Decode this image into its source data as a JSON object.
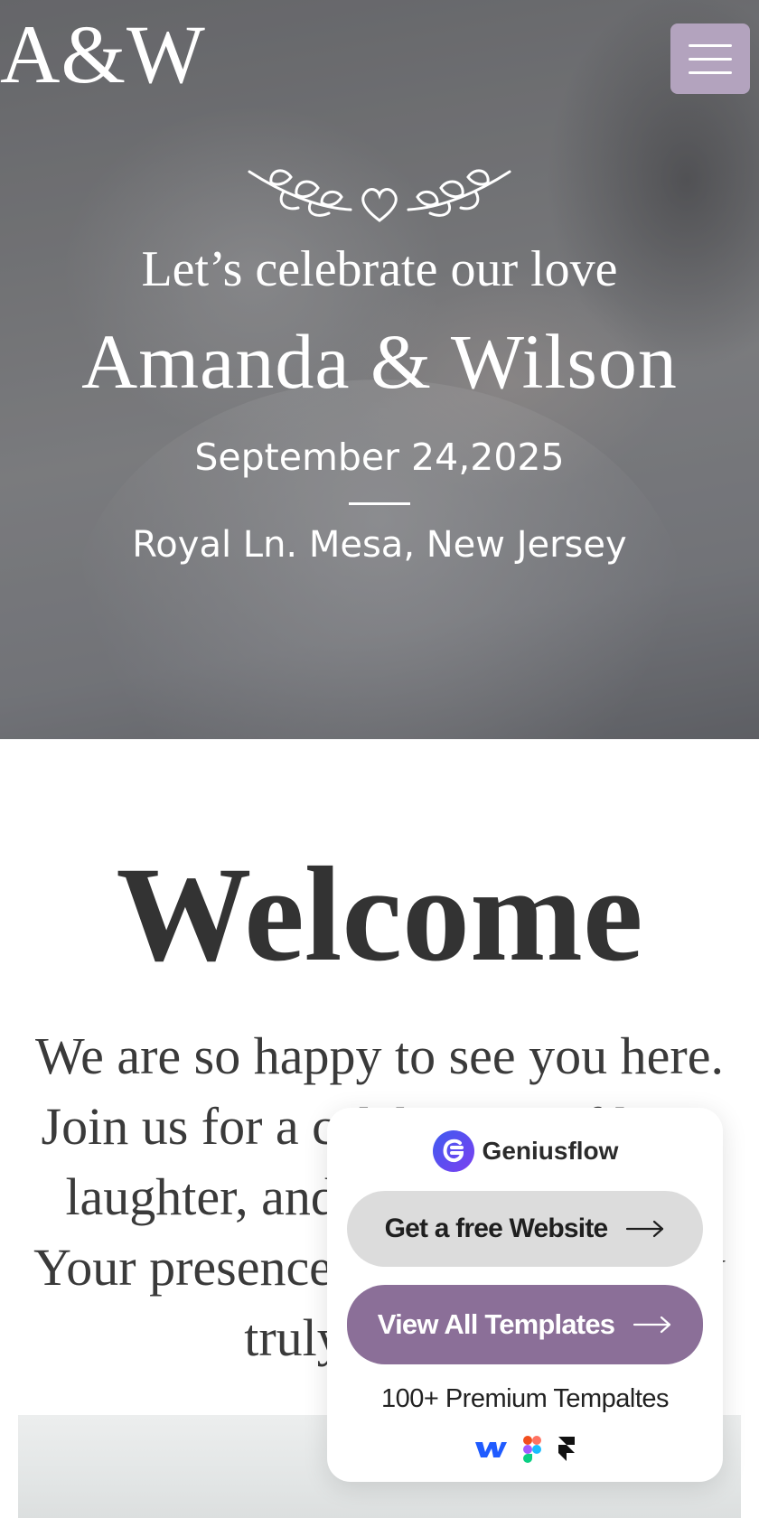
{
  "header": {
    "logo": "A&W",
    "menu_icon": "hamburger-menu-icon"
  },
  "hero": {
    "ornament_icon": "laurel-heart-icon",
    "tagline": "Let’s celebrate our love",
    "names": "Amanda & Wilson",
    "date": "September 24,2025",
    "location": "Royal Ln. Mesa, New Jersey"
  },
  "welcome": {
    "title": "Welcome",
    "lines": [
      "We are so happy to see you here.",
      "Join us for a celebration of love,",
      "laughter, and new beginnings.",
      "Your presence will make our day",
      "truly special."
    ]
  },
  "promo": {
    "brand": "Geniusflow",
    "brand_icon": "geniusflow-logo-icon",
    "free_website_label": "Get a free Website",
    "view_templates_label": "View All Templates",
    "premium_text": "100+ Premium Tempaltes",
    "tool_icons": [
      "webflow-icon",
      "figma-icon",
      "framer-icon"
    ]
  },
  "colors": {
    "menu_button": "#b3a3be",
    "templates_button": "#8b6f98",
    "free_button": "#dcdcdc",
    "text_dark": "#333333"
  }
}
